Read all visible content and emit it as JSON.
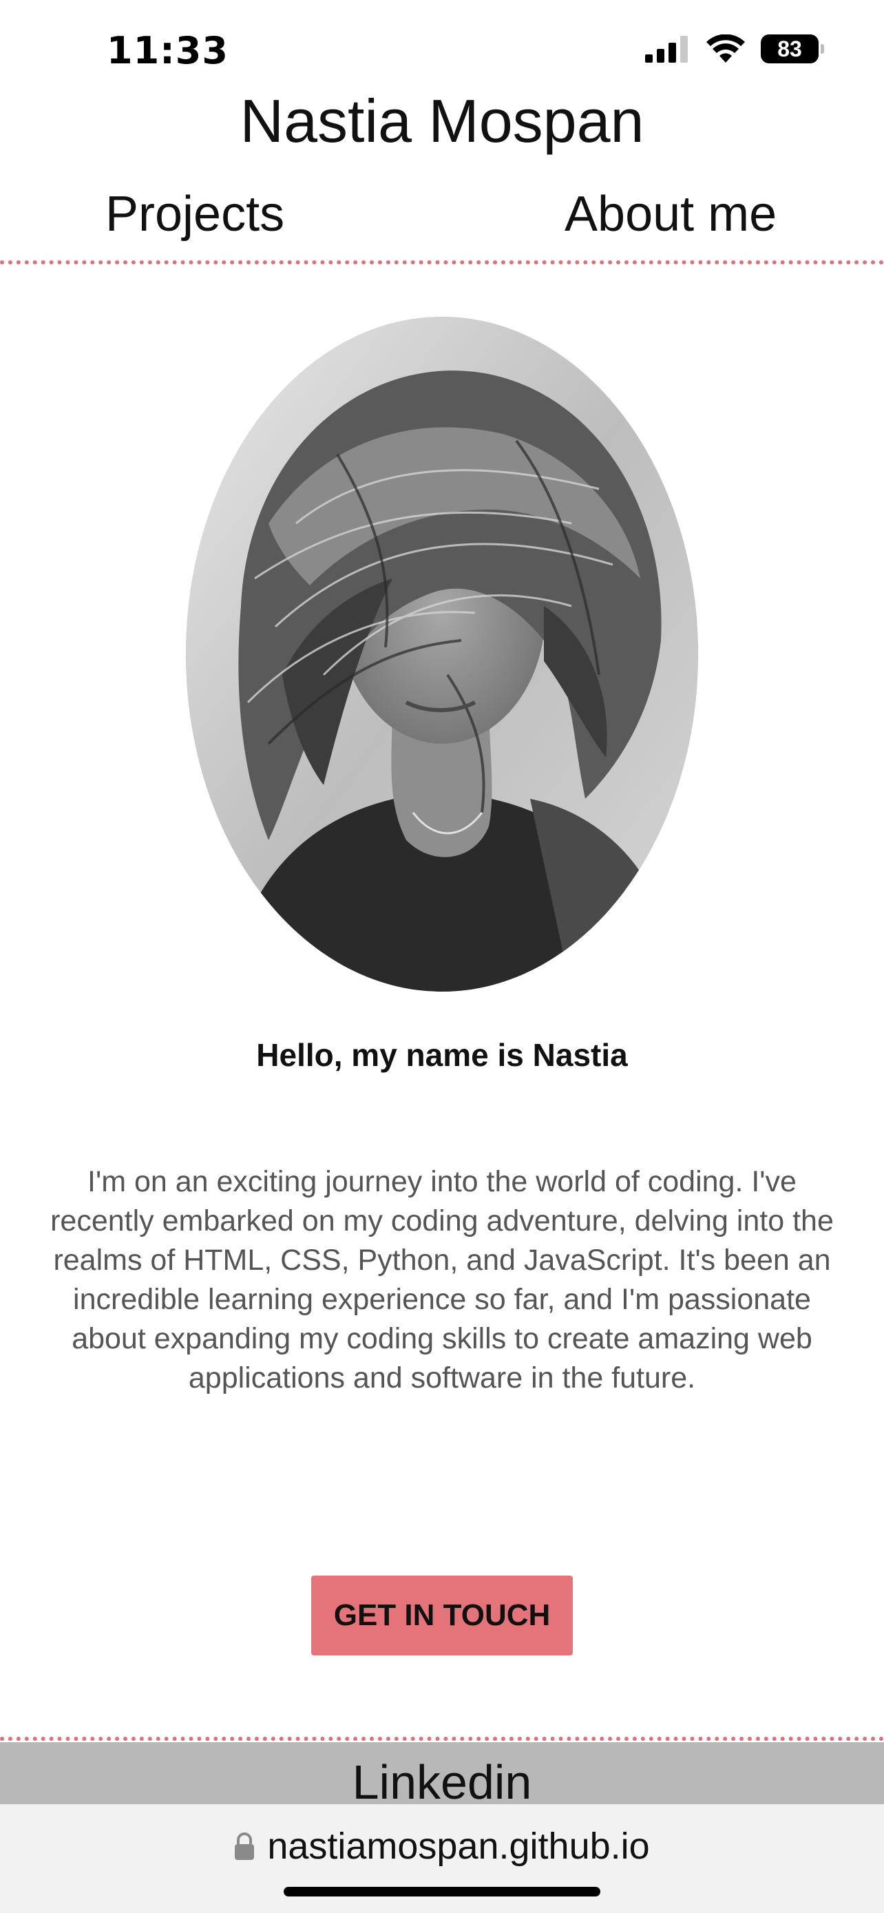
{
  "status_bar": {
    "time": "11:33",
    "battery_level": "83",
    "signal_icon": "cellular-signal-icon",
    "wifi_icon": "wifi-icon"
  },
  "header": {
    "title": "Nastia Mospan",
    "nav": {
      "projects": "Projects",
      "about": "About me"
    }
  },
  "main": {
    "greeting": "Hello, my name is Nastia",
    "bio": "I'm on an exciting journey into the world of coding. I've recently embarked on my coding adventure, delving into the realms of HTML, CSS, Python, and JavaScript. It's been an incredible learning experience so far, and I'm passionate about expanding my coding skills to create amazing web applications and software in the future.",
    "cta_label": "GET IN TOUCH"
  },
  "footer": {
    "link_label": "Linkedin"
  },
  "browser": {
    "url": "nastiamospan.github.io",
    "lock_icon": "lock-icon"
  },
  "colors": {
    "accent": "#e5747a",
    "rule": "#e07078",
    "footer_bg": "#b8b8b8"
  }
}
